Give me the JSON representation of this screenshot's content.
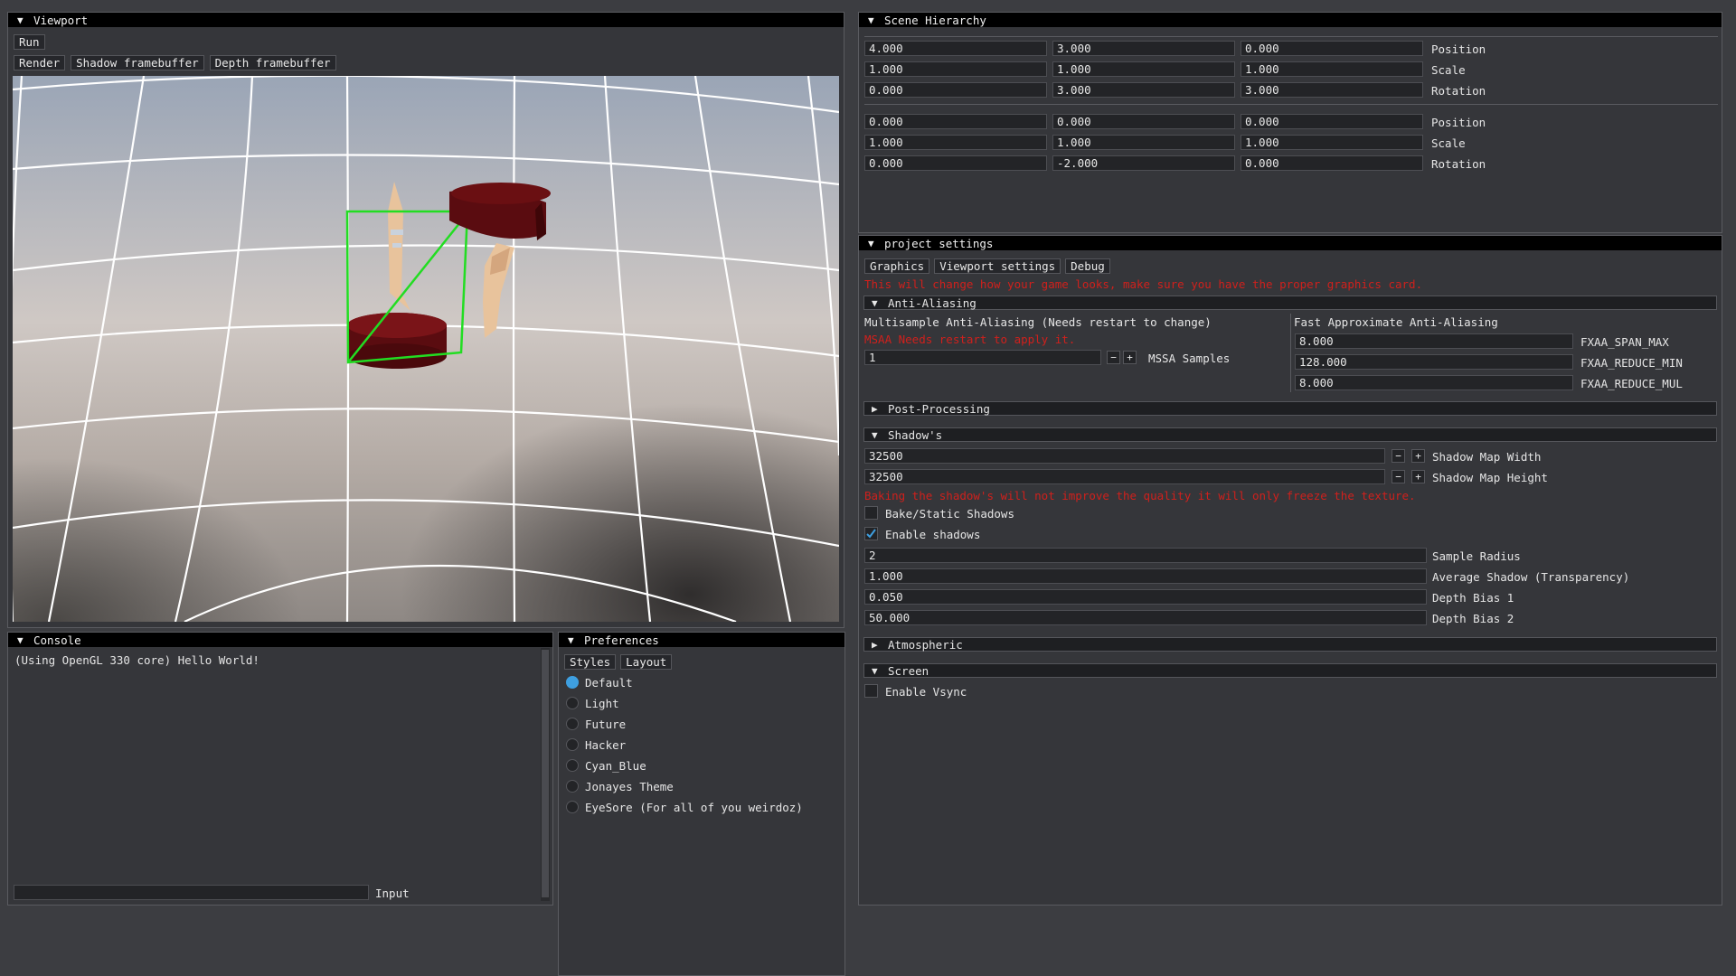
{
  "viewport": {
    "title": "Viewport",
    "run_label": "Run",
    "tabs": [
      "Render",
      "Shadow framebuffer",
      "Depth framebuffer"
    ]
  },
  "hierarchy": {
    "title": "Scene Hierarchy",
    "objects": [
      {
        "position": [
          "4.000",
          "3.000",
          "0.000"
        ],
        "scale": [
          "1.000",
          "1.000",
          "1.000"
        ],
        "rotation": [
          "0.000",
          "3.000",
          "3.000"
        ]
      },
      {
        "position": [
          "0.000",
          "0.000",
          "0.000"
        ],
        "scale": [
          "1.000",
          "1.000",
          "1.000"
        ],
        "rotation": [
          "0.000",
          "-2.000",
          "0.000"
        ]
      }
    ],
    "labels": {
      "position": "Position",
      "scale": "Scale",
      "rotation": "Rotation"
    }
  },
  "settings": {
    "title": "project settings",
    "tabs": [
      "Graphics",
      "Viewport settings",
      "Debug"
    ],
    "warning": "This will change how your game looks, make sure you have the proper graphics card.",
    "anti_aliasing": {
      "header": "Anti-Aliasing",
      "msaa_title": "Multisample Anti-Aliasing (Needs restart to change)",
      "msaa_warning": "MSAA Needs restart to apply it.",
      "msaa_value": "1",
      "msaa_label": "MSSA Samples",
      "fxaa_title": "Fast Approximate Anti-Aliasing",
      "fxaa": [
        {
          "value": "8.000",
          "label": "FXAA_SPAN_MAX"
        },
        {
          "value": "128.000",
          "label": "FXAA_REDUCE_MIN"
        },
        {
          "value": "8.000",
          "label": "FXAA_REDUCE_MUL"
        }
      ]
    },
    "post_processing": "Post-Processing",
    "shadows": {
      "header": "Shadow's",
      "map_width": {
        "value": "32500",
        "label": "Shadow Map Width"
      },
      "map_height": {
        "value": "32500",
        "label": "Shadow Map Height"
      },
      "warning": "Baking the shadow's will not improve the quality it will only freeze the texture.",
      "bake_label": "Bake/Static Shadows",
      "bake_checked": false,
      "enable_label": "Enable shadows",
      "enable_checked": true,
      "params": [
        {
          "value": "2",
          "label": "Sample Radius"
        },
        {
          "value": "1.000",
          "label": "Average Shadow (Transparency)"
        },
        {
          "value": "0.050",
          "label": "Depth Bias 1"
        },
        {
          "value": "50.000",
          "label": "Depth Bias 2"
        }
      ]
    },
    "atmospheric": "Atmospheric",
    "screen": {
      "header": "Screen",
      "vsync_label": "Enable Vsync",
      "vsync_checked": false
    }
  },
  "console": {
    "title": "Console",
    "log": "(Using OpenGL 330 core) Hello World!",
    "input_label": "Input",
    "input_value": ""
  },
  "preferences": {
    "title": "Preferences",
    "tabs": [
      "Styles",
      "Layout"
    ],
    "styles": [
      "Default",
      "Light",
      "Future",
      "Hacker",
      "Cyan_Blue",
      "Jonayes Theme",
      "EyeSore (For all of you weirdoz)"
    ],
    "selected_style": "Default"
  },
  "colors": {
    "accent": "#3e9fe0",
    "warning": "#d0201c",
    "selection": "#22dd22",
    "object": "#6a0f12"
  }
}
